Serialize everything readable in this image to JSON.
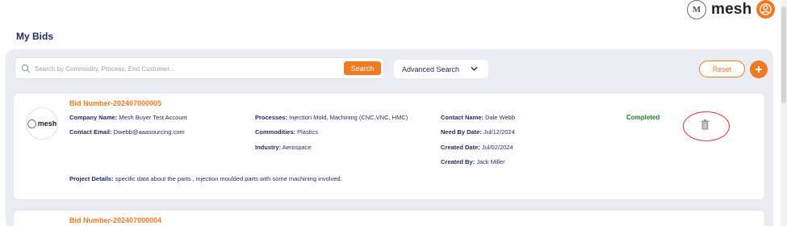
{
  "header": {
    "brand_name": "mesh",
    "brand_logo_letter": "M"
  },
  "page": {
    "title": "My Bids"
  },
  "search": {
    "placeholder": "Search by Commodity, Process, End Customer...",
    "value": "",
    "button_label": "Search",
    "advanced_label": "Advanced Search"
  },
  "actions": {
    "reset_label": "Reset"
  },
  "bids": [
    {
      "logo_text": "mesh",
      "bid_number": "Bid Number-202407000005",
      "company_label": "Company Name:",
      "company": "Mesh Buyer Test Account",
      "email_label": "Contact Email:",
      "email": "Dwebb@aaasourcing.com",
      "processes_label": "Processes:",
      "processes": "Injection Mold, Machining (CNC,VNC, HMC)",
      "commodities_label": "Commodities:",
      "commodities": "Plastics",
      "industry_label": "Industry:",
      "industry": "Aerospace",
      "contact_label": "Contact Name:",
      "contact": "Dale Webb",
      "need_by_label": "Need By Date:",
      "need_by": "Jul/12/2024",
      "created_date_label": "Created Date:",
      "created_date": "Jul/02/2024",
      "created_by_label": "Created By:",
      "created_by": "Jack Miller",
      "status": "Completed",
      "project_label": "Project Details:",
      "project_details": "specific data about the parts , injection moulded parts with some machining involved."
    },
    {
      "bid_number": "Bid Number-202407000004"
    }
  ],
  "colors": {
    "accent": "#f07a22",
    "navy": "#1f2a5a",
    "status_completed": "#1f7a2e",
    "highlight_ring": "#d23a3a"
  },
  "icons": [
    "mesh-logo-icon",
    "user-avatar-icon",
    "search-icon",
    "chevron-down-icon",
    "plus-icon",
    "trash-icon"
  ]
}
